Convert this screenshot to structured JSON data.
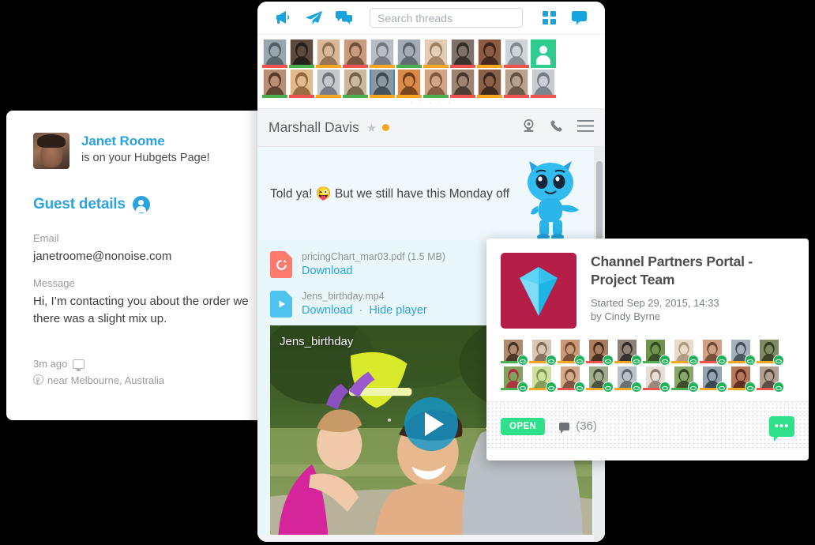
{
  "guest_card": {
    "name": "Janet Roome",
    "subtitle": "is on your Hubgets Page!",
    "details_title": "Guest details",
    "email_label": "Email",
    "email_value": "janetroome@nonoise.com",
    "message_label": "Message",
    "message_value": "Hi, I’m contacting you about the order we\nthere was a slight mix up.",
    "message_line1": "Hi, I’m contacting you about the order we",
    "message_line2": "there was a slight mix up.",
    "time_ago": "3m ago",
    "location": "near Melbourne, Australia",
    "accent_color": "#2ca3dd"
  },
  "chat_window": {
    "toolbar": {
      "icons_left": [
        "megaphone-icon",
        "paper-plane-icon",
        "chat-bubbles-icon"
      ],
      "icons_right": [
        "grid-icon",
        "chat-bubble-icon"
      ],
      "search_placeholder": "Search threads",
      "search_value": ""
    },
    "avatar_strip": {
      "pager_dots": "· · · · ·",
      "row1": [
        {
          "name": "contact-cyclist",
          "status": "#ef5350",
          "c1": "#9aa6ae",
          "c2": "#4c5a63"
        },
        {
          "name": "contact-man-suit",
          "status": "#4caf50",
          "c1": "#5d4a3c",
          "c2": "#1f1b18"
        },
        {
          "name": "contact-woman-blonde",
          "status": "#f5a623",
          "c1": "#d9b89a",
          "c2": "#8a6a4d"
        },
        {
          "name": "contact-man-smiling",
          "status": "#ef5350",
          "c1": "#c79b7c",
          "c2": "#6d4a35"
        },
        {
          "name": "contact-woman-short-hair",
          "status": "#f5a623",
          "c1": "#b7bdc2",
          "c2": "#6d7479"
        },
        {
          "name": "contact-man-glasses",
          "status": "#4caf50",
          "c1": "#a3acb2",
          "c2": "#565f66"
        },
        {
          "name": "contact-woman-long-hair",
          "status": "#f5a623",
          "c1": "#e3cdb5",
          "c2": "#9b7d5e"
        },
        {
          "name": "contact-man-sunglasses",
          "status": "#ef5350",
          "c1": "#7d7168",
          "c2": "#2e2823"
        },
        {
          "name": "contact-woman-dark",
          "status": "#f5a623",
          "c1": "#8b5c42",
          "c2": "#3a2119"
        },
        {
          "name": "contact-woman-pale",
          "status": "#ef5350",
          "c1": "#cfd4d8",
          "c2": "#7c8287"
        },
        {
          "name": "contact-placeholder",
          "status": "",
          "c1": "#2ecc8f",
          "c2": "#2ecc8f"
        }
      ],
      "row2": [
        {
          "name": "contact-woman-brunette",
          "status": "#4caf50",
          "c1": "#b98f73",
          "c2": "#513727"
        },
        {
          "name": "contact-woman-smiling",
          "status": "#ef5350",
          "c1": "#e0b98f",
          "c2": "#8d6038"
        },
        {
          "name": "contact-man-grey-suit",
          "status": "#f5a623",
          "c1": "#c3c8cc",
          "c2": "#6b7176"
        },
        {
          "name": "contact-woman-glasses",
          "status": "#4caf50",
          "c1": "#cdb79d",
          "c2": "#6f5a44"
        },
        {
          "name": "contact-man-selected",
          "status": "#f5a623",
          "c1": "#8d97a0",
          "c2": "#3c454c",
          "selected": true
        },
        {
          "name": "contact-woman-warm",
          "status": "#f5a623",
          "c1": "#d98b4a",
          "c2": "#6b3a16"
        },
        {
          "name": "contact-man-beard",
          "status": "#4caf50",
          "c1": "#cfa585",
          "c2": "#7a5238"
        },
        {
          "name": "contact-man-thinking",
          "status": "#ef5350",
          "c1": "#9d8370",
          "c2": "#403028"
        },
        {
          "name": "contact-man-dark",
          "status": "#f5a623",
          "c1": "#8a6047",
          "c2": "#33211a"
        },
        {
          "name": "contact-woman-office",
          "status": "#ef5350",
          "c1": "#b9a28d",
          "c2": "#5d4c3d"
        },
        {
          "name": "contact-woman-glasses-2",
          "status": "#ef5350",
          "c1": "#c9cdd1",
          "c2": "#6f767c"
        }
      ]
    },
    "header": {
      "title": "Marshall Davis",
      "star_icon": "star-icon",
      "presence_color": "#f5a623",
      "icons": [
        "webcam-icon",
        "phone-icon",
        "hamburger-menu-icon"
      ]
    },
    "message": {
      "text_before": "Told ya!",
      "emoji": "😜",
      "text_after": "But we still have this Monday off",
      "mascot": "blue-mascot-character"
    },
    "attachments": [
      {
        "icon": "pdf-file-icon",
        "name": "pricingChart_mar03.pdf (1.5 MB)",
        "links": [
          "Download"
        ],
        "kind": "pdf"
      },
      {
        "icon": "video-file-icon",
        "name": "Jens_birthday.mp4",
        "links": [
          "Download",
          "Hide player"
        ],
        "separator": "·",
        "kind": "video"
      }
    ],
    "video": {
      "label": "Jens_birthday",
      "play_icon": "play-icon"
    }
  },
  "project_card": {
    "thumb_icon": "diamond-icon",
    "thumb_bg": "#b51f47",
    "title": "Channel Partners Portal - Project Team",
    "started_label": "Started",
    "started_value": "Sep 29, 2015, 14:33",
    "author_line": "by Cindy Byrne",
    "members_row1": [
      {
        "name": "member-1",
        "status": "#4caf50",
        "c1": "#b08a6e",
        "c2": "#3c2a1e"
      },
      {
        "name": "member-2",
        "status": "#f5a623",
        "c1": "#d9c7b4",
        "c2": "#7a6754"
      },
      {
        "name": "member-3",
        "status": "#f5a623",
        "c1": "#c89a78",
        "c2": "#6b452c"
      },
      {
        "name": "member-4",
        "status": "#ef5350",
        "c1": "#a97e5e",
        "c2": "#3a2318"
      },
      {
        "name": "member-5",
        "status": "#f5a623",
        "c1": "#8c8174",
        "c2": "#2b2520"
      },
      {
        "name": "member-6",
        "status": "#4caf50",
        "c1": "#6f9450",
        "c2": "#2f4320"
      },
      {
        "name": "member-7",
        "status": "#f5a623",
        "c1": "#e8dcc9",
        "c2": "#a8937a"
      },
      {
        "name": "member-8",
        "status": "#ef5350",
        "c1": "#cfa083",
        "c2": "#6a4530"
      },
      {
        "name": "member-9",
        "status": "#f5a623",
        "c1": "#a5b0ba",
        "c2": "#3e4a55"
      },
      {
        "name": "member-10",
        "status": "#f5a623",
        "c1": "#7e8a62",
        "c2": "#32381f"
      }
    ],
    "members_row2": [
      {
        "name": "member-11",
        "status": "#4caf50",
        "c1": "#7fa35a",
        "c2": "#b5243a"
      },
      {
        "name": "member-12",
        "status": "#f5a623",
        "c1": "#cfe0a0",
        "c2": "#7b8f4c"
      },
      {
        "name": "member-13",
        "status": "#ef5350",
        "c1": "#d4a88a",
        "c2": "#6d4a32"
      },
      {
        "name": "member-14",
        "status": "#f5a623",
        "c1": "#9eae8d",
        "c2": "#3b4434"
      },
      {
        "name": "member-15",
        "status": "#f5a623",
        "c1": "#b9c2c8",
        "c2": "#5b6469"
      },
      {
        "name": "member-16",
        "status": "#ef5350",
        "c1": "#e7dfd6",
        "c2": "#8a7a6b"
      },
      {
        "name": "member-17",
        "status": "#4caf50",
        "c1": "#87a86a",
        "c2": "#31401f"
      },
      {
        "name": "member-18",
        "status": "#f5a623",
        "c1": "#93a4b0",
        "c2": "#2d3942"
      },
      {
        "name": "member-19",
        "status": "#f5a623",
        "c1": "#b4775a",
        "c2": "#53221b"
      },
      {
        "name": "member-20",
        "status": "#ef5350",
        "c1": "#b2a090",
        "c2": "#4e4038"
      }
    ],
    "status_badge": "OPEN",
    "status_badge_color": "#2ee08a",
    "comment_count": "(36)",
    "comment_icon": "comment-icon",
    "action_icon": "more-chat-icon",
    "action_label": "•••"
  }
}
